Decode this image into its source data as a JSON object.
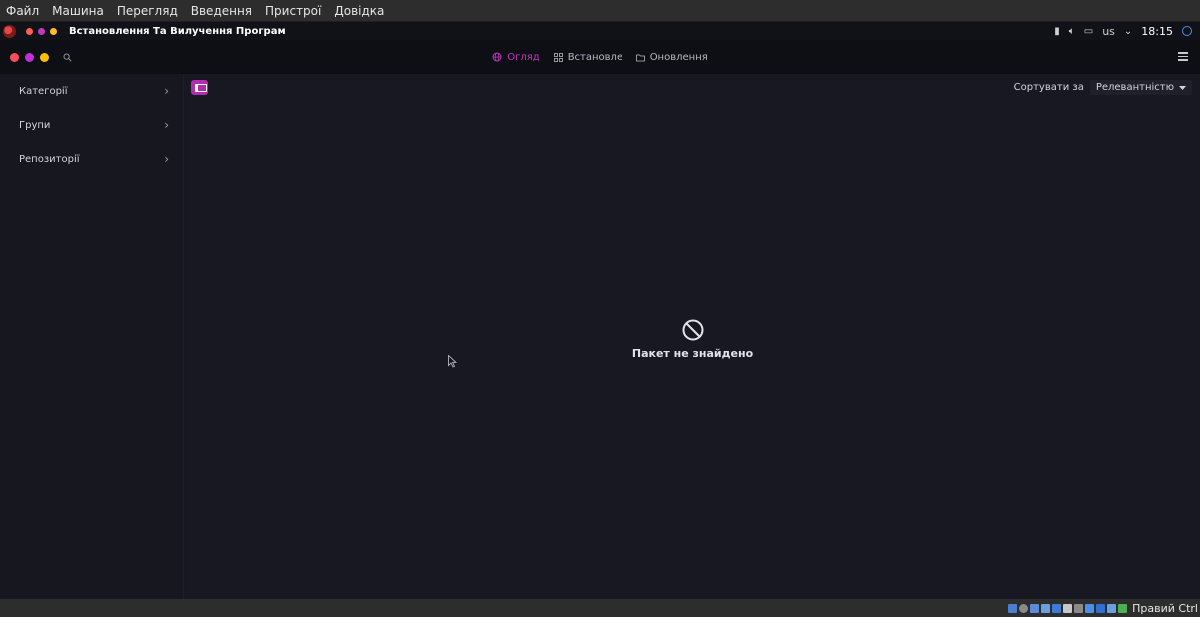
{
  "vbox_menu": [
    "Файл",
    "Машина",
    "Перегляд",
    "Введення",
    "Пристрої",
    "Довідка"
  ],
  "guest_topbar": {
    "title": "Встановлення Та Вилучення Програм",
    "keyboard_layout": "us",
    "clock": "18:15",
    "dot_colors": [
      "#ff5f57",
      "#c137c1",
      "#ffbd2e"
    ]
  },
  "app_header": {
    "tabs": [
      {
        "label": "Огляд",
        "icon": "globe-icon",
        "active": true
      },
      {
        "label": "Встановлені",
        "icon": "grid-icon",
        "active": false
      },
      {
        "label": "Оновлення",
        "icon": "folder-icon",
        "active": false
      }
    ],
    "accent": "#c234c2"
  },
  "sidebar": {
    "items": [
      {
        "label": "Категорії"
      },
      {
        "label": "Групи"
      },
      {
        "label": "Репозиторії"
      }
    ]
  },
  "main": {
    "sort_label": "Сортувати за",
    "sort_value": "Релевантністю",
    "empty_message": "Пакет не знайдено"
  },
  "vbox_status": {
    "host_key": "Правий Ctrl"
  }
}
